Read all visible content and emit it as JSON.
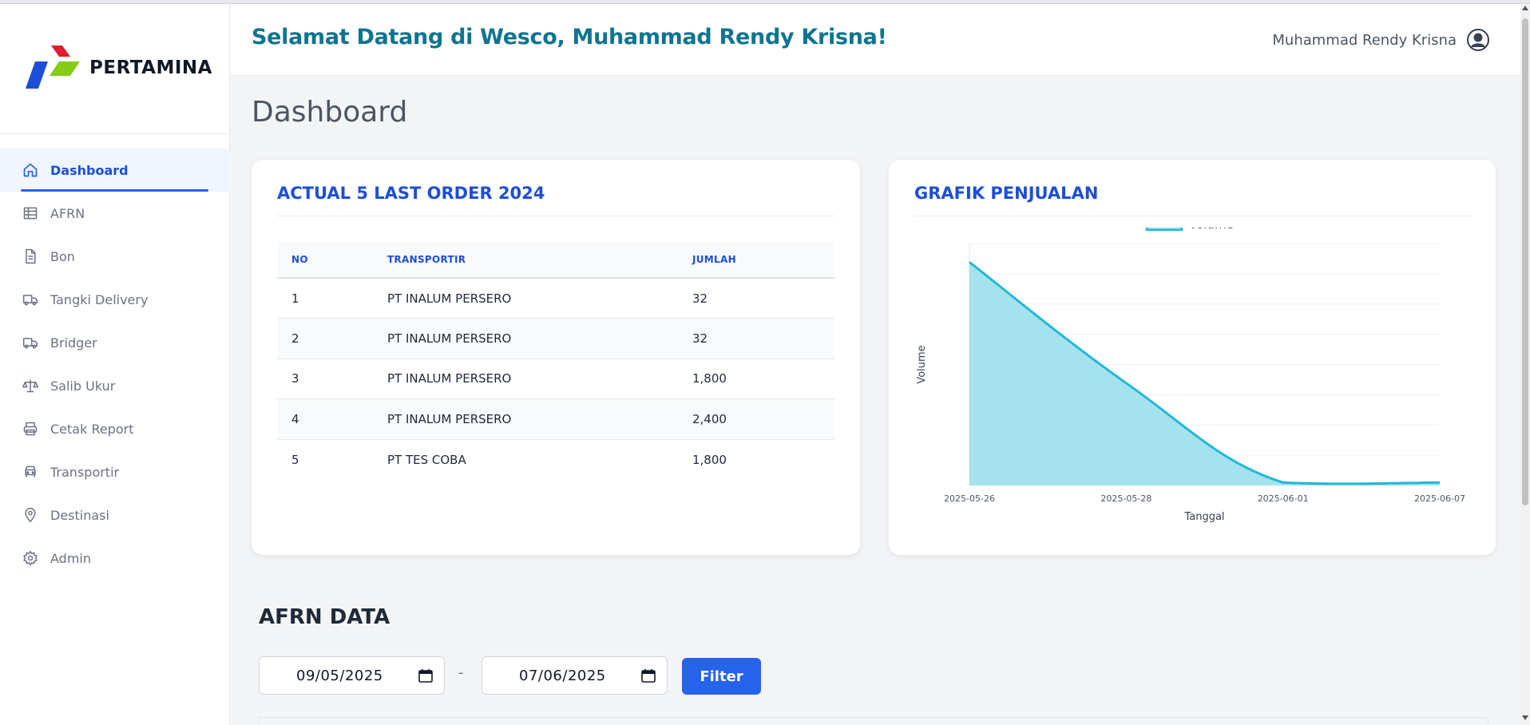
{
  "app": {
    "brand": "PERTAMINA",
    "welcome": "Selamat Datang di Wesco, Muhammad Rendy Krisna!",
    "user_name": "Muhammad Rendy Krisna",
    "page_title": "Dashboard"
  },
  "sidebar": {
    "items": [
      {
        "label": "Dashboard",
        "icon": "home-icon",
        "active": true
      },
      {
        "label": "AFRN",
        "icon": "table-icon"
      },
      {
        "label": "Bon",
        "icon": "document-icon"
      },
      {
        "label": "Tangki Delivery",
        "icon": "truck-icon"
      },
      {
        "label": "Bridger",
        "icon": "truck-icon"
      },
      {
        "label": "Salib Ukur",
        "icon": "scale-icon"
      },
      {
        "label": "Cetak Report",
        "icon": "printer-icon"
      },
      {
        "label": "Transportir",
        "icon": "vehicle-icon"
      },
      {
        "label": "Destinasi",
        "icon": "location-pin-icon"
      },
      {
        "label": "Admin",
        "icon": "gear-icon"
      }
    ]
  },
  "orders": {
    "title": "ACTUAL 5 LAST ORDER 2024",
    "headers": [
      "NO",
      "TRANSPORTIR",
      "JUMLAH"
    ],
    "rows": [
      [
        "1",
        "PT INALUM PERSERO",
        "32"
      ],
      [
        "2",
        "PT INALUM PERSERO",
        "32"
      ],
      [
        "3",
        "PT INALUM PERSERO",
        "1,800"
      ],
      [
        "4",
        "PT INALUM PERSERO",
        "2,400"
      ],
      [
        "5",
        "PT TES COBA",
        "1,800"
      ]
    ]
  },
  "sales_chart": {
    "title": "GRAFIK PENJUALAN",
    "colors": {
      "line": "#22b8d6",
      "fill": "#9fe0ec"
    }
  },
  "chart_data": {
    "type": "area",
    "title": "",
    "xlabel": "Tanggal",
    "ylabel": "Volume",
    "legend": "top-center",
    "grid": true,
    "x": [
      "2025-05-26",
      "2025-05-28",
      "2025-06-01",
      "2025-06-07"
    ],
    "series": [
      {
        "name": "Volume",
        "values": [
          2400,
          1100,
          32,
          32
        ]
      }
    ],
    "ylim": [
      0,
      2600
    ]
  },
  "afrn": {
    "title": "AFRN DATA",
    "date_from": "09/05/2025",
    "separator": "-",
    "date_to": "07/06/2025",
    "filter_label": "Filter"
  }
}
